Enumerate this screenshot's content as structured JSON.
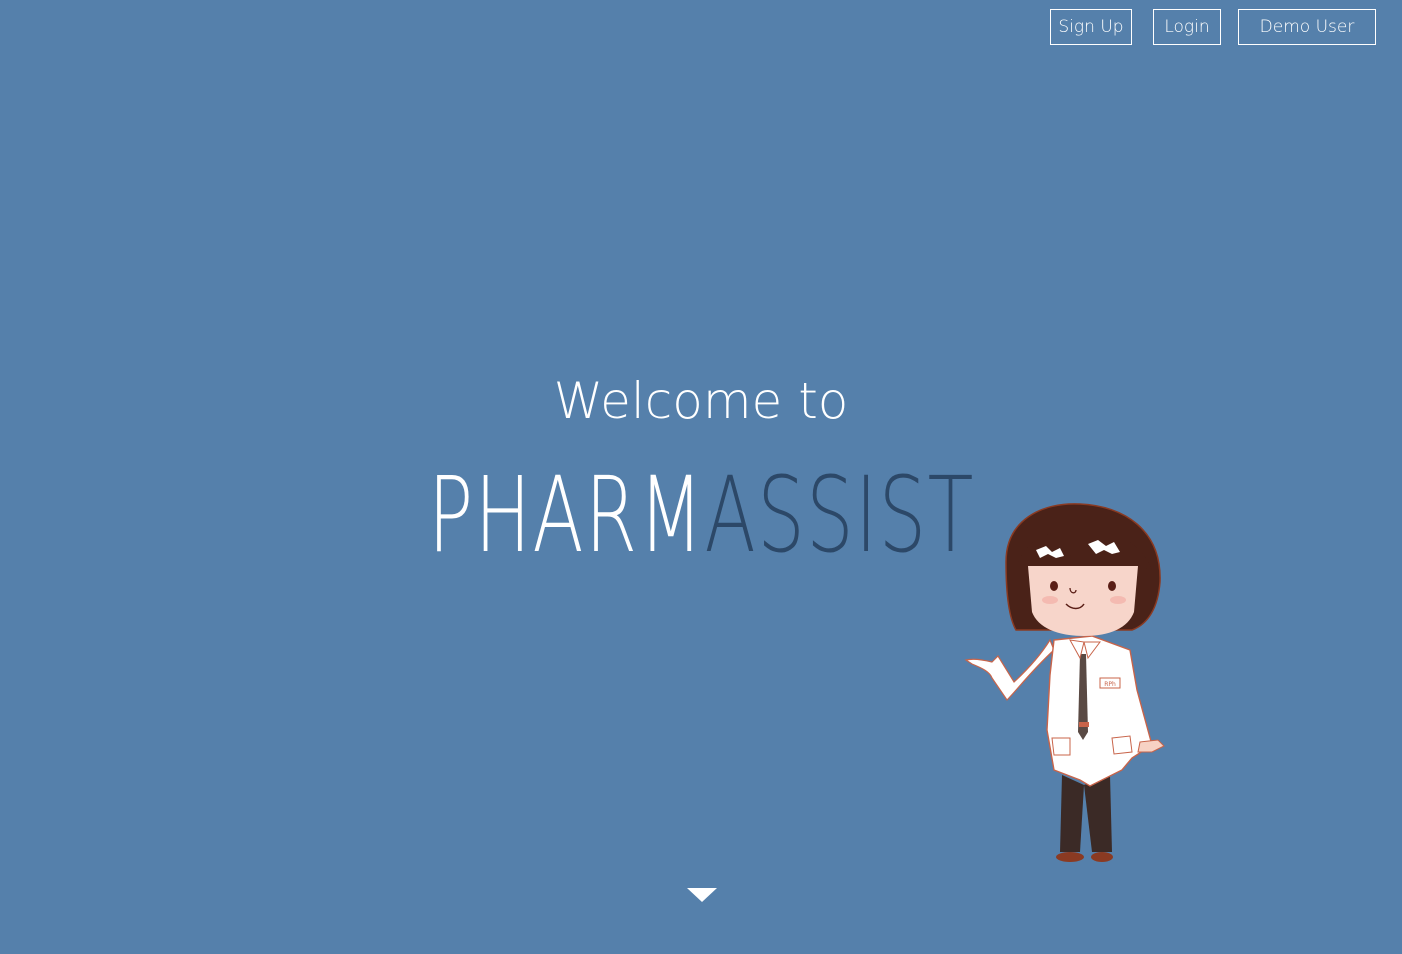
{
  "nav": {
    "signup_label": "Sign Up",
    "login_label": "Login",
    "demo_label": "Demo User"
  },
  "hero": {
    "welcome_text": "Welcome to",
    "brand_part1": "PHARM",
    "brand_part2": "ASSIST",
    "badge_text": "RPh"
  },
  "colors": {
    "background": "#5580ab",
    "brand_light": "#ffffff",
    "brand_dark": "#2c4868"
  },
  "icons": {
    "scroll_down": "triangle-down-icon",
    "mascot": "pharmacist-illustration"
  }
}
